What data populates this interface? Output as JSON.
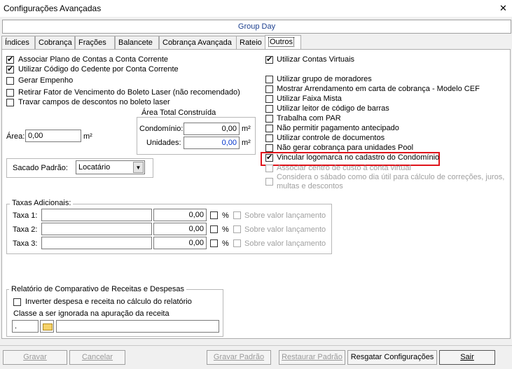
{
  "window": {
    "title": "Configurações Avançadas",
    "close": "✕"
  },
  "group_label": "Group Day",
  "tabs": [
    "Índices",
    "Cobrança",
    "Frações",
    "Balancete",
    "Cobrança Avançada",
    "Rateio",
    "Outros"
  ],
  "active_tab": "Outros",
  "left_checks": [
    {
      "label": "Associar Plano de Contas a Conta Corrente",
      "checked": true
    },
    {
      "label": "Utilizar Código do Cedente por Conta Corrente",
      "checked": true
    },
    {
      "label": "Gerar Empenho",
      "checked": false
    },
    {
      "label": "Retirar Fator de Vencimento do Boleto Laser (não recomendado)",
      "checked": false
    },
    {
      "label": "Travar campos de descontos no boleto laser",
      "checked": false
    }
  ],
  "right_checks": [
    {
      "label": "Utilizar Contas Virtuais",
      "checked": true,
      "disabled": false
    },
    {
      "label": "Utilizar grupo de moradores",
      "checked": false,
      "disabled": false
    },
    {
      "label": "Mostrar Arrendamento em carta de cobrança - Modelo CEF",
      "checked": false,
      "disabled": false
    },
    {
      "label": "Utilizar Faixa Mista",
      "checked": false,
      "disabled": false
    },
    {
      "label": "Utilizar leitor de código de barras",
      "checked": false,
      "disabled": false
    },
    {
      "label": "Trabalha com PAR",
      "checked": false,
      "disabled": false
    },
    {
      "label": "Não permitir pagamento antecipado",
      "checked": false,
      "disabled": false
    },
    {
      "label": "Utilizar controle de documentos",
      "checked": false,
      "disabled": false
    },
    {
      "label": "Não gerar cobrança para unidades Pool",
      "checked": false,
      "disabled": false
    },
    {
      "label": "Vincular logomarca no cadastro do Condomínio",
      "checked": true,
      "disabled": false
    },
    {
      "label": "Associar centro de custo à conta virtual",
      "checked": false,
      "disabled": true
    },
    {
      "label": "Considera o sábado como dia útil para cálculo de correções, juros,",
      "label2": "multas e descontos",
      "checked": false,
      "disabled": true
    }
  ],
  "area": {
    "label": "Área:",
    "value": "0,00",
    "unit": "m²"
  },
  "area_total": {
    "legend": "Área Total Construída",
    "condominio_label": "Condomínio:",
    "condominio_value": "0,00",
    "unidades_label": "Unidades:",
    "unidades_value": "0,00",
    "unit": "m²"
  },
  "sacado": {
    "label": "Sacado Padrão:",
    "value": "Locatário"
  },
  "taxas": {
    "legend": "Taxas Adicionais:",
    "rows": [
      {
        "label": "Taxa 1:",
        "desc": "",
        "value": "0,00",
        "pct": "%",
        "sobre": "Sobre valor lançamento"
      },
      {
        "label": "Taxa 2:",
        "desc": "",
        "value": "0,00",
        "pct": "%",
        "sobre": "Sobre valor lançamento"
      },
      {
        "label": "Taxa 3:",
        "desc": "",
        "value": "0,00",
        "pct": "%",
        "sobre": "Sobre valor lançamento"
      }
    ]
  },
  "relatorio": {
    "legend": "Relatório de Comparativo de Receitas e Despesas",
    "inverter_label": "Inverter despesa e receita no cálculo do relatório",
    "classe_label": "Classe a ser ignorada na apuração da receita",
    "classe_code": ".",
    "classe_desc": ""
  },
  "buttons": {
    "gravar": "Gravar",
    "cancelar": "Cancelar",
    "gravar_padrao": "Gravar Padrão",
    "restaurar_padrao": "Restaurar Padrão",
    "resgatar": "Resgatar Configurações",
    "sair": "Sair"
  }
}
